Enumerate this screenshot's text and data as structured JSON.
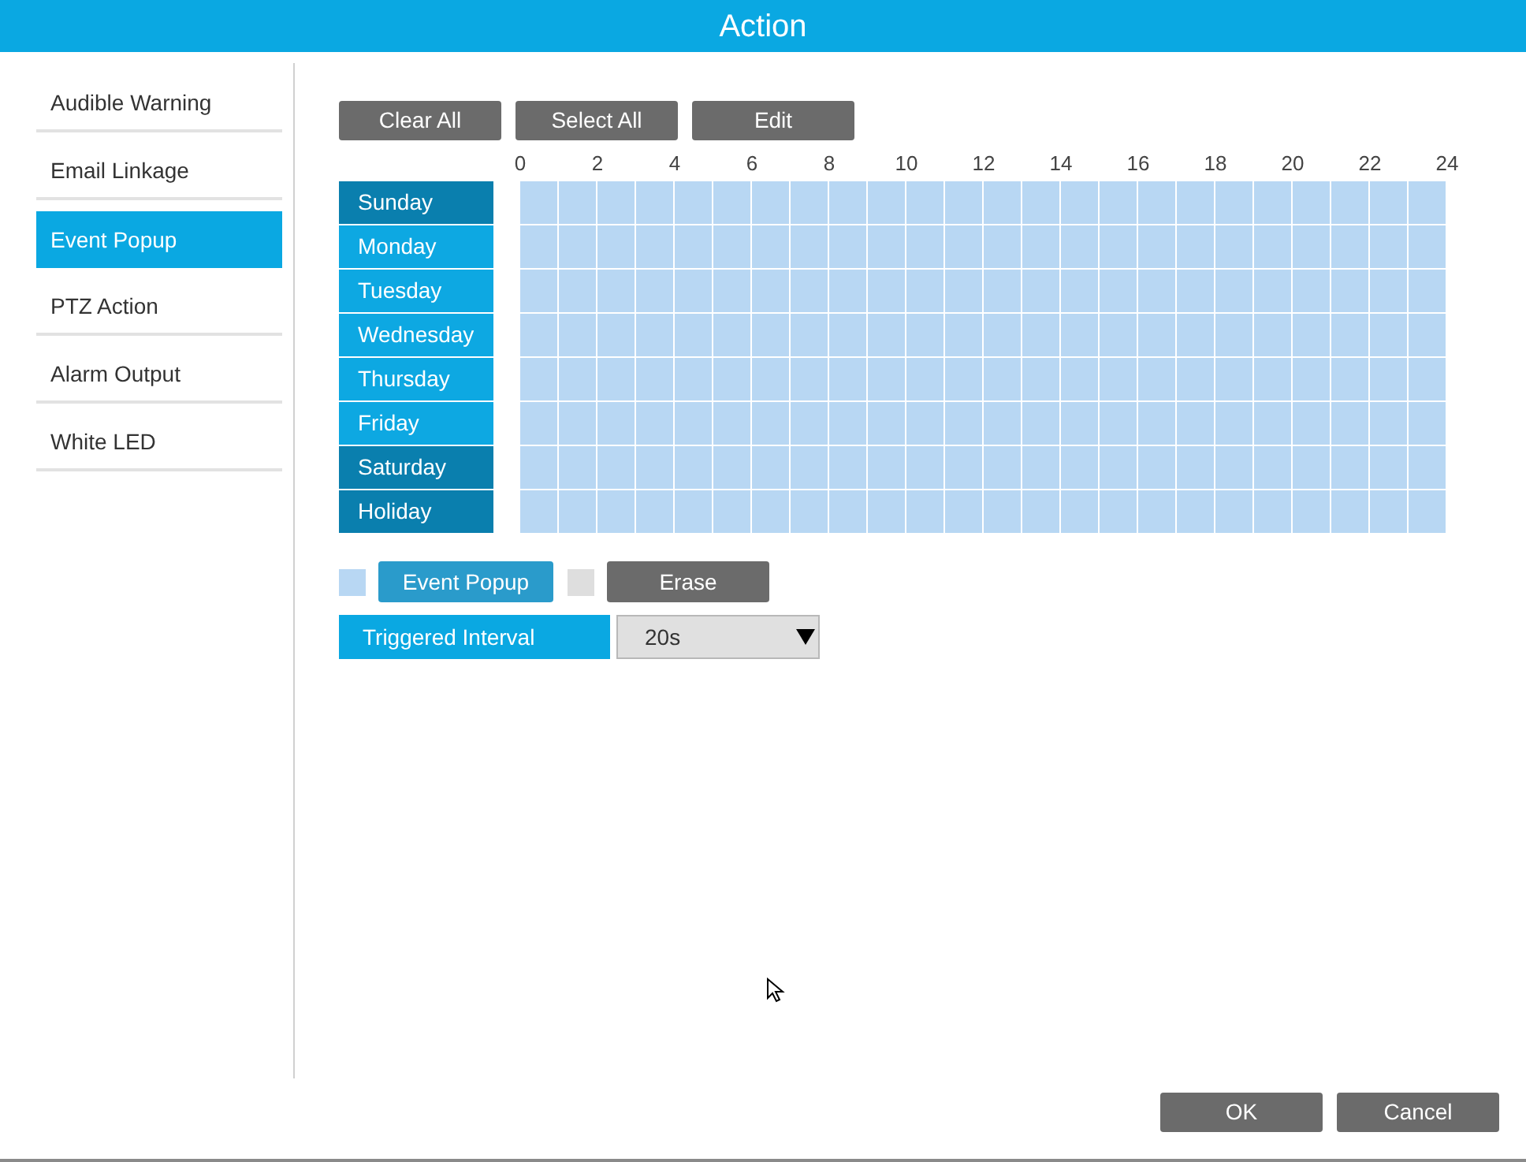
{
  "window": {
    "title": "Action"
  },
  "sidebar": {
    "items": [
      {
        "label": "Audible Warning",
        "selected": false
      },
      {
        "label": "Email Linkage",
        "selected": false
      },
      {
        "label": "Event Popup",
        "selected": true
      },
      {
        "label": "PTZ Action",
        "selected": false
      },
      {
        "label": "Alarm Output",
        "selected": false
      },
      {
        "label": "White LED",
        "selected": false
      }
    ]
  },
  "toolbar": [
    "Clear All",
    "Select All",
    "Edit"
  ],
  "schedule": {
    "hours": [
      "0",
      "2",
      "4",
      "6",
      "8",
      "10",
      "12",
      "14",
      "16",
      "18",
      "20",
      "22",
      "24"
    ],
    "days": [
      {
        "label": "Sunday",
        "color": "#0a7fae",
        "scheduled": true
      },
      {
        "label": "Monday",
        "color": "#0da8e2",
        "scheduled": true
      },
      {
        "label": "Tuesday",
        "color": "#0da8e2",
        "scheduled": true
      },
      {
        "label": "Wednesday",
        "color": "#0da8e2",
        "scheduled": true
      },
      {
        "label": "Thursday",
        "color": "#0da8e2",
        "scheduled": true
      },
      {
        "label": "Friday",
        "color": "#0da8e2",
        "scheduled": true
      },
      {
        "label": "Saturday",
        "color": "#0a7fae",
        "scheduled": true
      },
      {
        "label": "Holiday",
        "color": "#0a7fae",
        "scheduled": true
      }
    ]
  },
  "legend": [
    {
      "label": "Event Popup",
      "color": "#b8d7f3",
      "selected": true
    },
    {
      "label": "Erase",
      "color": "#dedede",
      "selected": false
    }
  ],
  "triggered_interval": {
    "label": "Triggered Interval",
    "value": "20s"
  },
  "buttons": [
    "OK",
    "Cancel"
  ]
}
